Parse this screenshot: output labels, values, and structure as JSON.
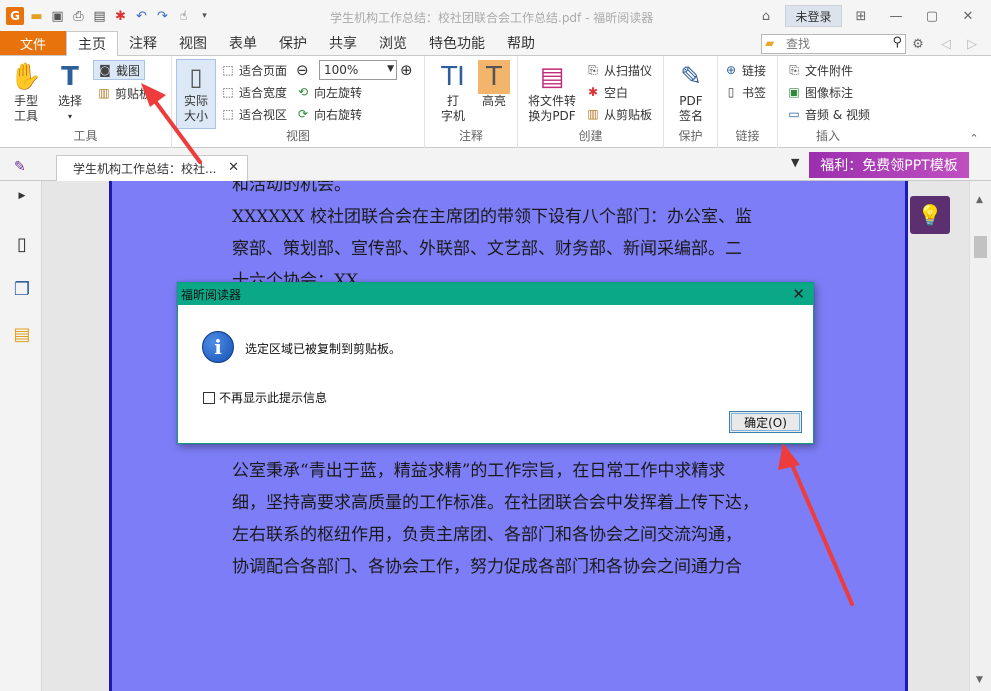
{
  "window": {
    "title": "学生机构工作总结：校社团联合会工作总结.pdf - 福昕阅读器",
    "login_label": "未登录"
  },
  "menu": {
    "file": "文件",
    "tabs": [
      "主页",
      "注释",
      "视图",
      "表单",
      "保护",
      "共享",
      "浏览",
      "特色功能",
      "帮助"
    ],
    "search_placeholder": "查找"
  },
  "ribbon": {
    "tools": {
      "label": "工具",
      "hand": "手型\n工具",
      "select": "选择",
      "screenshot": "截图",
      "clipboard": "剪贴板"
    },
    "view": {
      "label": "视图",
      "actual_size": "实际\n大小",
      "fit_page": "适合页面",
      "fit_width": "适合宽度",
      "fit_visible": "适合视区",
      "zoom_value": "100%",
      "rotate_left": "向左旋转",
      "rotate_right": "向右旋转"
    },
    "annotate": {
      "label": "注释",
      "typewriter": "打\n字机",
      "highlight": "高亮"
    },
    "create": {
      "label": "创建",
      "convert": "将文件转\n换为PDF",
      "from_scanner": "从扫描仪",
      "blank": "空白",
      "from_clipboard": "从剪贴板"
    },
    "protect": {
      "label": "保护",
      "pdf_sign": "PDF\n签名"
    },
    "links": {
      "label": "链接",
      "link": "链接",
      "bookmark": "书签"
    },
    "insert": {
      "label": "插入",
      "attachment": "文件附件",
      "image_annot": "图像标注",
      "audio_video": "音频 & 视频"
    }
  },
  "doc_tab": {
    "title": "学生机构工作总结：校社..."
  },
  "promo": "福利：免费领PPT模板",
  "document": {
    "lines": [
      "和活动的机会。",
      "XXXXXX 校社团联合会在主席团的带领下设有八个部门：办公室、监",
      "察部、策划部、宣传部、外联部、文艺部、财务部、新闻采编部。二",
      "十六个协会：XX",
      "公室秉承“青出于蓝，精益求精”的工作宗旨，在日常工作中求精求",
      "细，坚持高要求高质量的工作标准。在社团联合会中发挥着上传下达，",
      "左右联系的枢纽作用，负责主席团、各部门和各协会之间交流沟通，",
      "协调配合各部门、各协会工作，努力促成各部门和各协会之间通力合"
    ]
  },
  "dialog": {
    "title": "福昕阅读器",
    "message": "选定区域已被复制到剪贴板。",
    "checkbox_label": "不再显示此提示信息",
    "ok_label": "确定(O)"
  },
  "colors": {
    "accent": "#e8720c",
    "dialog_title": "#0aa887",
    "page_bg": "#7d7df7",
    "arrow": "#ee3b3b"
  }
}
